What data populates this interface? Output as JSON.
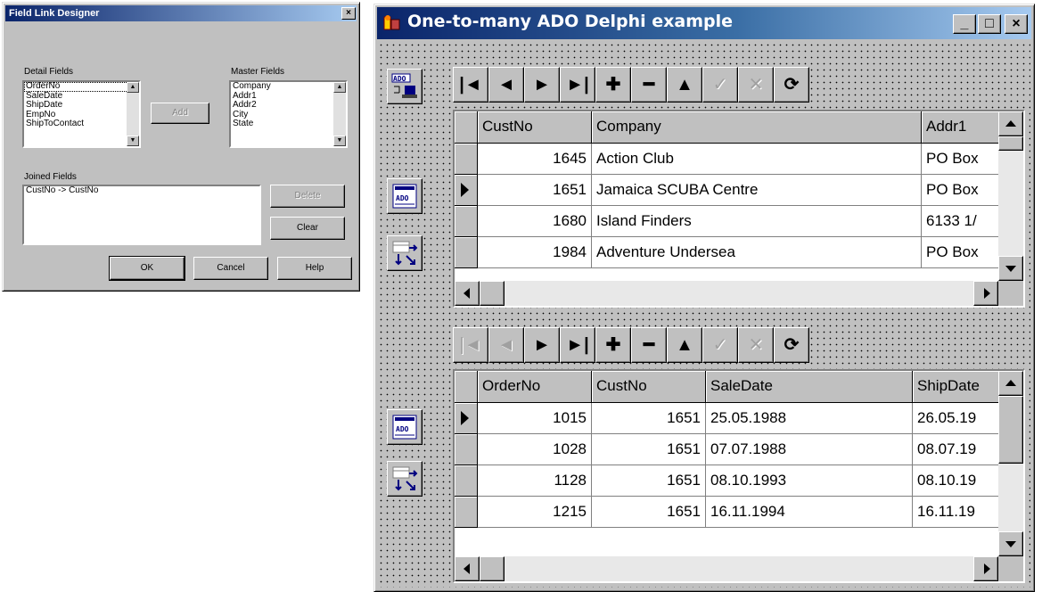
{
  "field_link_designer": {
    "title": "Field Link Designer",
    "close_glyph": "×",
    "detail_fields_label": "Detail Fields",
    "detail_fields": [
      "OrderNo",
      "SaleDate",
      "ShipDate",
      "EmpNo",
      "ShipToContact"
    ],
    "master_fields_label": "Master Fields",
    "master_fields": [
      "Company",
      "Addr1",
      "Addr2",
      "City",
      "State"
    ],
    "add_label": "Add",
    "joined_fields_label": "Joined Fields",
    "joined_fields": [
      "CustNo -> CustNo"
    ],
    "delete_label": "Delete",
    "clear_label": "Clear",
    "ok_label": "OK",
    "cancel_label": "Cancel",
    "help_label": "Help"
  },
  "main_window": {
    "title": "One-to-many ADO Delphi example",
    "minimize_glyph": "_",
    "maximize_glyph": "□",
    "close_glyph": "×",
    "component_icons": [
      "ado-connection-icon",
      "ado-dataset-icon",
      "datasource-icon"
    ],
    "navigator_glyphs": {
      "first": "|◄",
      "prior": "◄",
      "next": "►",
      "last": "►|",
      "insert": "✚",
      "delete": "━",
      "edit": "▲",
      "post": "✓",
      "cancel": "✕",
      "refresh": "⟳"
    },
    "master_grid": {
      "columns": [
        "CustNo",
        "Company",
        "Addr1"
      ],
      "rows": [
        {
          "custno": "1645",
          "company": "Action Club",
          "addr1": "PO Box"
        },
        {
          "custno": "1651",
          "company": "Jamaica SCUBA Centre",
          "addr1": "PO Box"
        },
        {
          "custno": "1680",
          "company": "Island Finders",
          "addr1": "6133 1/"
        },
        {
          "custno": "1984",
          "company": "Adventure Undersea",
          "addr1": "PO Box"
        }
      ]
    },
    "detail_grid": {
      "columns": [
        "OrderNo",
        "CustNo",
        "SaleDate",
        "ShipDate"
      ],
      "rows": [
        {
          "orderno": "1015",
          "custno": "1651",
          "saledate": "25.05.1988",
          "shipdate": "26.05.19"
        },
        {
          "orderno": "1028",
          "custno": "1651",
          "saledate": "07.07.1988",
          "shipdate": "08.07.19"
        },
        {
          "orderno": "1128",
          "custno": "1651",
          "saledate": "08.10.1993",
          "shipdate": "08.10.19"
        },
        {
          "orderno": "1215",
          "custno": "1651",
          "saledate": "16.11.1994",
          "shipdate": "16.11.19"
        }
      ]
    }
  },
  "colors": {
    "title_bar_start": "#0a246a",
    "title_bar_end": "#a6caf0",
    "face": "#c0c0c0"
  }
}
